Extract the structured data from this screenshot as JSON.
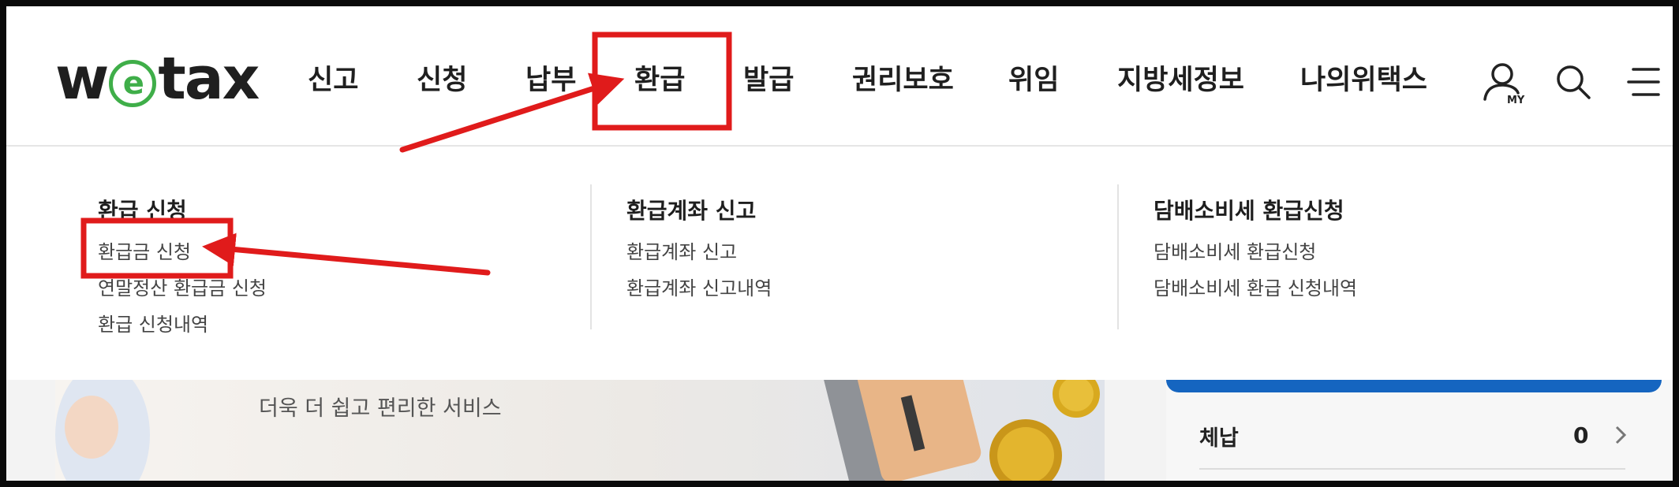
{
  "logo": {
    "pre": "w",
    "mid": "e",
    "post": "tax"
  },
  "nav": [
    {
      "label": "신고"
    },
    {
      "label": "신청"
    },
    {
      "label": "납부"
    },
    {
      "label": "환급"
    },
    {
      "label": "발급"
    },
    {
      "label": "권리보호"
    },
    {
      "label": "위임"
    },
    {
      "label": "지방세정보"
    },
    {
      "label": "나의위택스"
    }
  ],
  "header_icons": [
    "my-page-icon",
    "search-icon",
    "menu-icon"
  ],
  "my_icon_label": "MY",
  "mega_menu": {
    "columns": [
      {
        "title": "환급 신청",
        "links": [
          "환급금 신청",
          "연말정산 환급금 신청",
          "환급 신청내역"
        ]
      },
      {
        "title": "환급계좌 신고",
        "links": [
          "환급계좌 신고",
          "환급계좌 신고내역"
        ]
      },
      {
        "title": "담배소비세 환급신청",
        "links": [
          "담배소비세 환급신청",
          "담배소비세 환급 신청내역"
        ]
      }
    ]
  },
  "banner": {
    "tagline": "더욱 더 쉽고 편리한 서비스"
  },
  "side_panel": {
    "row_label": "체납",
    "row_count": "0"
  },
  "colors": {
    "brand_green": "#3fae49",
    "accent_blue": "#1565c0",
    "annotation_red": "#e01b1b"
  }
}
